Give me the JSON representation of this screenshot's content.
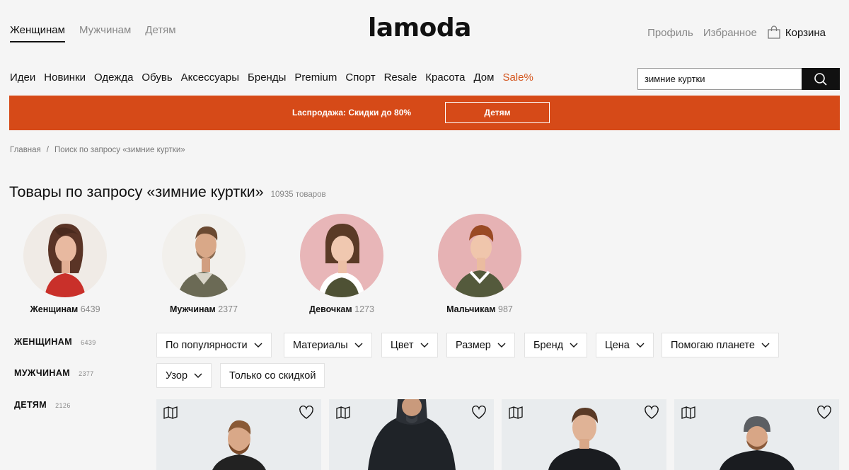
{
  "header": {
    "gender_tabs": [
      "Женщинам",
      "Мужчинам",
      "Детям"
    ],
    "active_gender": "Женщинам",
    "logo": "lamoda",
    "profile_label": "Профиль",
    "favorites_label": "Избранное",
    "cart_label": "Корзина"
  },
  "categories": [
    "Идеи",
    "Новинки",
    "Одежда",
    "Обувь",
    "Аксессуары",
    "Бренды",
    "Premium",
    "Спорт",
    "Resale",
    "Красота",
    "Дом",
    "Sale%"
  ],
  "search": {
    "value": "зимние куртки",
    "placeholder": ""
  },
  "promo": {
    "text": "Lаспродажа: Скидки до 80%",
    "button_label": "Детям",
    "color": "#d64a18"
  },
  "breadcrumb": [
    "Главная",
    "/",
    "Поиск по запросу «зимние куртки»"
  ],
  "title": {
    "text": "Товары по запросу «зимние куртки»",
    "count": "10935 товаров"
  },
  "gender_cards": [
    {
      "label": "Женщинам",
      "count": "6439"
    },
    {
      "label": "Мужчинам",
      "count": "2377"
    },
    {
      "label": "Девочкам",
      "count": "1273"
    },
    {
      "label": "Мальчикам",
      "count": "987"
    }
  ],
  "sidebar": [
    {
      "label": "ЖЕНЩИНАМ",
      "count": "6439"
    },
    {
      "label": "МУЖЧИНАМ",
      "count": "2377"
    },
    {
      "label": "ДЕТЯМ",
      "count": "2126"
    }
  ],
  "filters": [
    "По популярности",
    "Материалы",
    "Цвет",
    "Размер",
    "Бренд",
    "Цена",
    "Помогаю планете",
    "Узор",
    "Только со скидкой"
  ],
  "icons": {
    "cart": "shopping-bag-icon",
    "search": "search-icon",
    "favorite": "heart-icon",
    "size_guide": "size-guide-icon",
    "dropdown": "chevron-down-icon"
  },
  "colors": {
    "accent": "#d64a18",
    "sale": "#d4541c",
    "text": "#111111",
    "muted": "#888888"
  }
}
